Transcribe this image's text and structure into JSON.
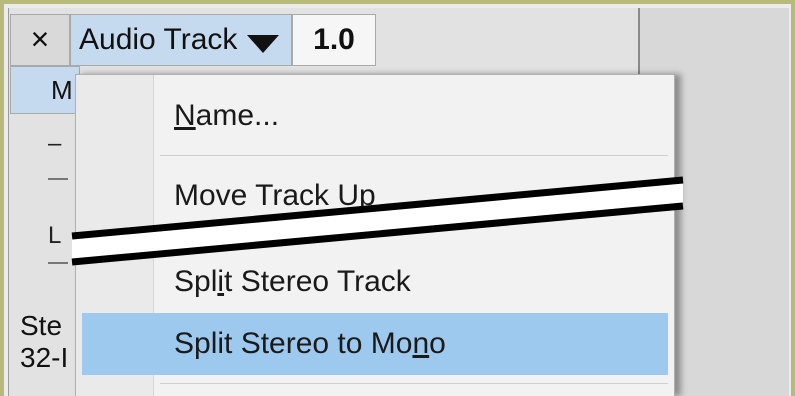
{
  "track_header": {
    "close_label": "×",
    "name_label": "Audio Track",
    "rate_value": "1.0",
    "mute_partial": "M",
    "gain_label": "–",
    "pan_label": "L",
    "info_line1": "Ste",
    "info_line2": "32-I"
  },
  "menu": {
    "items": [
      {
        "pre": "",
        "ul": "N",
        "post": "ame..."
      },
      {
        "pre": "Move Track Up",
        "ul": "",
        "post": ""
      },
      {
        "pre": "Spl",
        "ul": "i",
        "post": "t Stereo Track"
      },
      {
        "pre": "Split Stereo to Mo",
        "ul": "n",
        "post": "o"
      }
    ],
    "highlight_color": "#9dc9ef"
  }
}
